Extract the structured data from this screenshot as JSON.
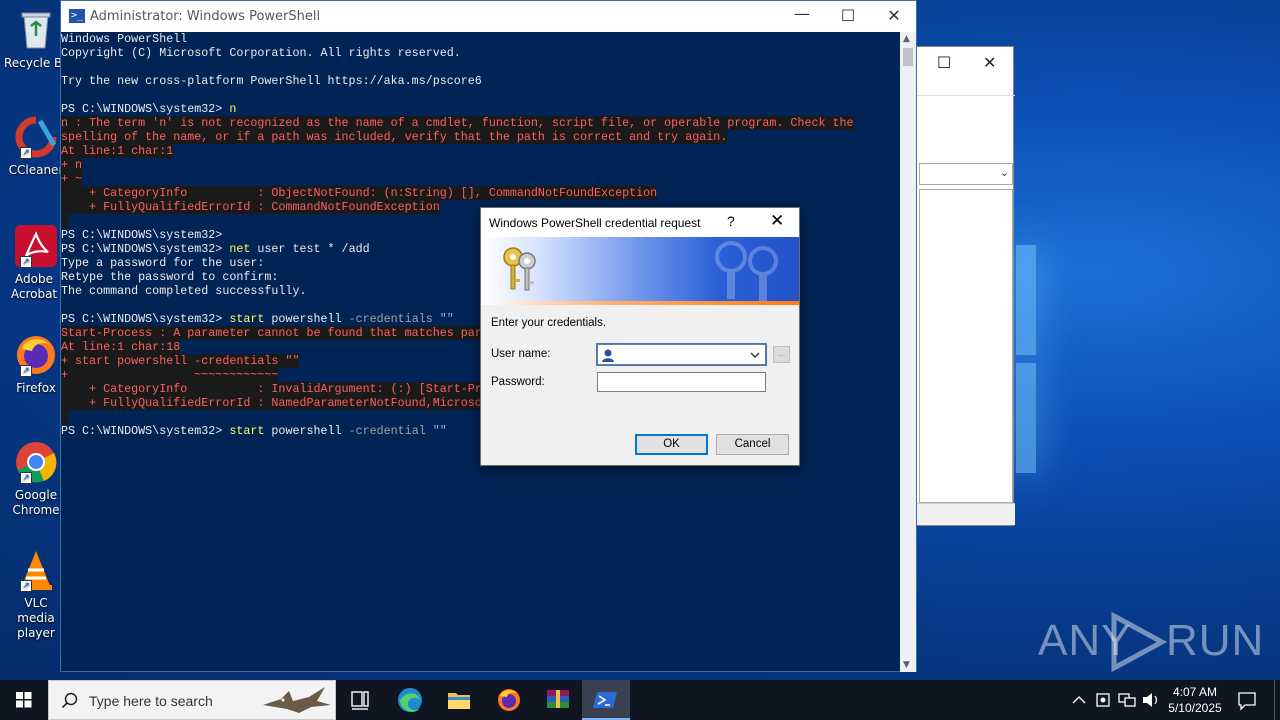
{
  "desktop": {
    "icons": [
      {
        "label": "Recycle Bin",
        "icon": "recycle-bin-icon"
      },
      {
        "label": "CCleaner",
        "icon": "ccleaner-icon"
      },
      {
        "label": "Adobe Acrobat",
        "icon": "adobe-acrobat-icon"
      },
      {
        "label": "Firefox",
        "icon": "firefox-icon"
      },
      {
        "label": "Google Chrome",
        "icon": "chrome-icon"
      },
      {
        "label": "VLC media player",
        "icon": "vlc-icon"
      }
    ],
    "watermark": {
      "left": "ANY",
      "right": "RUN"
    }
  },
  "powershell": {
    "title": "Administrator: Windows PowerShell",
    "lines": [
      {
        "t": "Windows PowerShell",
        "k": "n"
      },
      {
        "t": "Copyright (C) Microsoft Corporation. All rights reserved.",
        "k": "n"
      },
      {
        "t": "",
        "k": "n"
      },
      {
        "t": "Try the new cross-platform PowerShell https://aka.ms/pscore6",
        "k": "n"
      },
      {
        "t": "",
        "k": "n"
      },
      {
        "t": "PS C:\\WINDOWS\\system32> ",
        "k": "p",
        "c": "n"
      },
      {
        "t": "n : The term 'n' is not recognized as the name of a cmdlet, function, script file, or operable program. Check the",
        "k": "e"
      },
      {
        "t": "spelling of the name, or if a path was included, verify that the path is correct and try again.",
        "k": "e"
      },
      {
        "t": "At line:1 char:1",
        "k": "e"
      },
      {
        "t": "+ n",
        "k": "e"
      },
      {
        "t": "+ ~",
        "k": "e"
      },
      {
        "t": "    + CategoryInfo          : ObjectNotFound: (n:String) [], CommandNotFoundException",
        "k": "e"
      },
      {
        "t": "    + FullyQualifiedErrorId : CommandNotFoundException",
        "k": "e"
      },
      {
        "t": " ",
        "k": "s"
      },
      {
        "t": "PS C:\\WINDOWS\\system32>",
        "k": "n"
      },
      {
        "t": "PS C:\\WINDOWS\\system32> ",
        "k": "p",
        "c": "net",
        "a": " user test * /add"
      },
      {
        "t": "Type a password for the user:",
        "k": "n"
      },
      {
        "t": "Retype the password to confirm:",
        "k": "n"
      },
      {
        "t": "The command completed successfully.",
        "k": "n"
      },
      {
        "t": "",
        "k": "n"
      },
      {
        "t": "PS C:\\WINDOWS\\system32> ",
        "k": "p",
        "c": "start",
        "a": " powershell ",
        "pa": "-credentials",
        "s": " \"\""
      },
      {
        "t": "Start-Process : A parameter cannot be found that matches par",
        "k": "e"
      },
      {
        "t": "At line:1 char:18",
        "k": "e"
      },
      {
        "t": "+ start powershell -credentials \"\"",
        "k": "e"
      },
      {
        "t": "+                  ~~~~~~~~~~~~",
        "k": "e"
      },
      {
        "t": "    + CategoryInfo          : InvalidArgument: (:) [Start-Pr",
        "k": "e"
      },
      {
        "t": "    + FullyQualifiedErrorId : NamedParameterNotFound,Microso",
        "k": "e"
      },
      {
        "t": " ",
        "k": "s"
      },
      {
        "t": "PS C:\\WINDOWS\\system32> ",
        "k": "p",
        "c": "start",
        "a": " powershell ",
        "pa": "-credential",
        "s": " \"\""
      }
    ]
  },
  "dialog": {
    "title": "Windows PowerShell credential request",
    "help": "?",
    "close": "✕",
    "prompt": "Enter your credentials.",
    "username_label": "User name:",
    "username_value": "",
    "password_label": "Password:",
    "browse_label": "...",
    "ok_label": "OK",
    "cancel_label": "Cancel"
  },
  "taskbar": {
    "search_placeholder": "Type here to search",
    "time": "4:07 AM",
    "date": "5/10/2025"
  }
}
